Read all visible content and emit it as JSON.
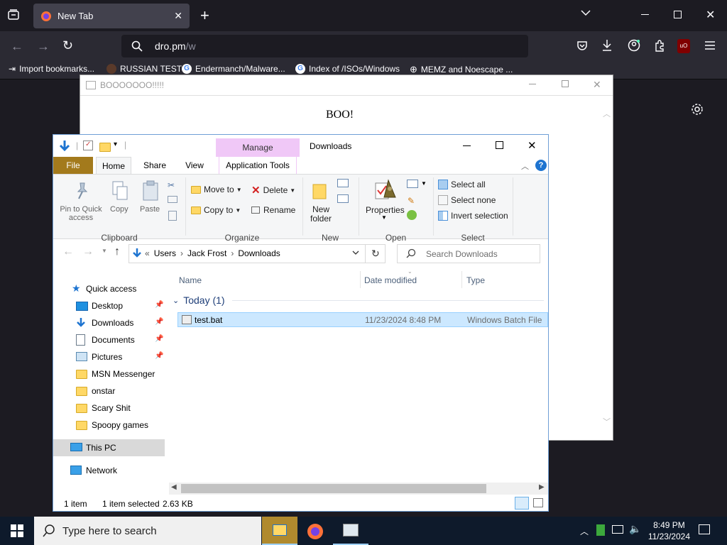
{
  "browser": {
    "tab_title": "New Tab",
    "url_host": "dro.pm",
    "url_path": "/w",
    "bookmarks": [
      "Import bookmarks...",
      "RUSSIAN TEST",
      "Endermanch/Malware...",
      "Index of /ISOs/Windows",
      "MEMZ and Noescape ..."
    ]
  },
  "popup": {
    "title": "BOOOOOOO!!!!!",
    "text": "BOO!"
  },
  "explorer": {
    "title": "Downloads",
    "context_tab": "Manage",
    "tabs": [
      "File",
      "Home",
      "Share",
      "View",
      "Application Tools"
    ],
    "ribbon": {
      "pin_label": "Pin to Quick access",
      "copy": "Copy",
      "paste": "Paste",
      "clipboard": "Clipboard",
      "move_to": "Move to",
      "copy_to": "Copy to",
      "delete": "Delete",
      "rename": "Rename",
      "organize": "Organize",
      "new_folder": "New folder",
      "new": "New",
      "properties": "Properties",
      "open": "Open",
      "select_all": "Select all",
      "select_none": "Select none",
      "invert_selection": "Invert selection",
      "select": "Select"
    },
    "breadcrumb": [
      "Users",
      "Jack Frost",
      "Downloads"
    ],
    "search_placeholder": "Search Downloads",
    "nav": {
      "quick_access": "Quick access",
      "items": [
        "Desktop",
        "Downloads",
        "Documents",
        "Pictures",
        "MSN Messenger",
        "onstar",
        "Scary Shit",
        "Spoopy games"
      ],
      "this_pc": "This PC",
      "network": "Network"
    },
    "columns": [
      "Name",
      "Date modified",
      "Type"
    ],
    "group": "Today (1)",
    "files": [
      {
        "name": "test.bat",
        "date": "11/23/2024 8:48 PM",
        "type": "Windows Batch File"
      }
    ],
    "status": {
      "count": "1 item",
      "selected": "1 item selected",
      "size": "2.63 KB"
    }
  },
  "taskbar": {
    "search_placeholder": "Type here to search",
    "time": "8:49 PM",
    "date": "11/23/2024"
  }
}
